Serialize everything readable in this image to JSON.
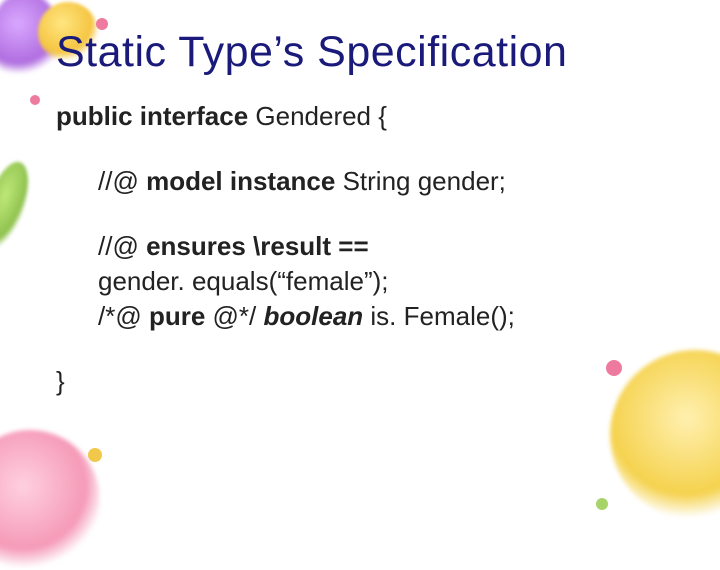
{
  "title": "Static Type’s Specification",
  "code": {
    "decl_kw": "public interface",
    "decl_name": " Gendered {",
    "model_prefix": "//@ ",
    "model_kw": "model instance",
    "model_rest": " String gender;",
    "ensures_prefix": "//@ ",
    "ensures_kw": "ensures",
    "ensures_rest": " \\result == ",
    "ensures_line2": "gender. equals(“female”);",
    "pure_open": "/*@ ",
    "pure_kw": "pure",
    "pure_close": " @*/ ",
    "bool_kw": "boolean",
    "method": " is. Female();",
    "close": "}"
  }
}
